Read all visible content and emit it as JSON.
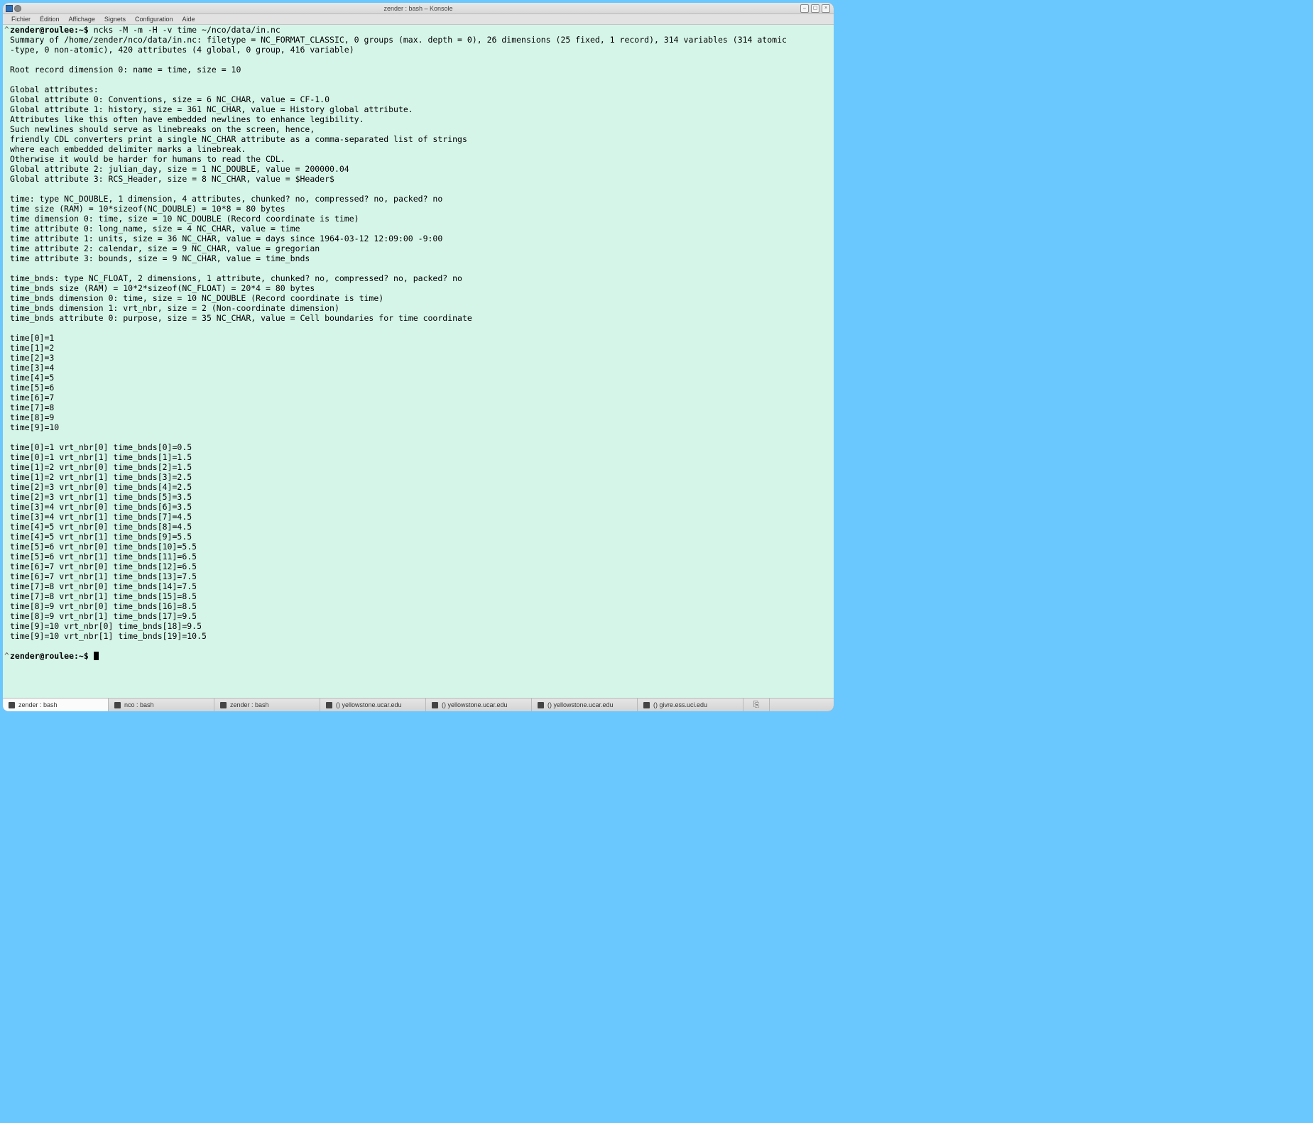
{
  "window": {
    "title": "zender : bash – Konsole"
  },
  "menu": {
    "items": [
      "Fichier",
      "Édition",
      "Affichage",
      "Signets",
      "Configuration",
      "Aide"
    ]
  },
  "prompt": "zender@roulee:~$ ",
  "command": "ncks -M -m -H -v time ~/nco/data/in.nc",
  "output_lines": [
    "Summary of /home/zender/nco/data/in.nc: filetype = NC_FORMAT_CLASSIC, 0 groups (max. depth = 0), 26 dimensions (25 fixed, 1 record), 314 variables (314 atomic",
    "-type, 0 non-atomic), 420 attributes (4 global, 0 group, 416 variable)",
    "",
    "Root record dimension 0: name = time, size = 10",
    "",
    "Global attributes:",
    "Global attribute 0: Conventions, size = 6 NC_CHAR, value = CF-1.0",
    "Global attribute 1: history, size = 361 NC_CHAR, value = History global attribute.",
    "Attributes like this often have embedded newlines to enhance legibility.",
    "Such newlines should serve as linebreaks on the screen, hence,",
    "friendly CDL converters print a single NC_CHAR attribute as a comma-separated list of strings",
    "where each embedded delimiter marks a linebreak.",
    "Otherwise it would be harder for humans to read the CDL.",
    "Global attribute 2: julian_day, size = 1 NC_DOUBLE, value = 200000.04",
    "Global attribute 3: RCS_Header, size = 8 NC_CHAR, value = $Header$",
    "",
    "time: type NC_DOUBLE, 1 dimension, 4 attributes, chunked? no, compressed? no, packed? no",
    "time size (RAM) = 10*sizeof(NC_DOUBLE) = 10*8 = 80 bytes",
    "time dimension 0: time, size = 10 NC_DOUBLE (Record coordinate is time)",
    "time attribute 0: long_name, size = 4 NC_CHAR, value = time",
    "time attribute 1: units, size = 36 NC_CHAR, value = days since 1964-03-12 12:09:00 -9:00",
    "time attribute 2: calendar, size = 9 NC_CHAR, value = gregorian",
    "time attribute 3: bounds, size = 9 NC_CHAR, value = time_bnds",
    "",
    "time_bnds: type NC_FLOAT, 2 dimensions, 1 attribute, chunked? no, compressed? no, packed? no",
    "time_bnds size (RAM) = 10*2*sizeof(NC_FLOAT) = 20*4 = 80 bytes",
    "time_bnds dimension 0: time, size = 10 NC_DOUBLE (Record coordinate is time)",
    "time_bnds dimension 1: vrt_nbr, size = 2 (Non-coordinate dimension)",
    "time_bnds attribute 0: purpose, size = 35 NC_CHAR, value = Cell boundaries for time coordinate",
    "",
    "time[0]=1",
    "time[1]=2",
    "time[2]=3",
    "time[3]=4",
    "time[4]=5",
    "time[5]=6",
    "time[6]=7",
    "time[7]=8",
    "time[8]=9",
    "time[9]=10",
    "",
    "time[0]=1 vrt_nbr[0] time_bnds[0]=0.5",
    "time[0]=1 vrt_nbr[1] time_bnds[1]=1.5",
    "time[1]=2 vrt_nbr[0] time_bnds[2]=1.5",
    "time[1]=2 vrt_nbr[1] time_bnds[3]=2.5",
    "time[2]=3 vrt_nbr[0] time_bnds[4]=2.5",
    "time[2]=3 vrt_nbr[1] time_bnds[5]=3.5",
    "time[3]=4 vrt_nbr[0] time_bnds[6]=3.5",
    "time[3]=4 vrt_nbr[1] time_bnds[7]=4.5",
    "time[4]=5 vrt_nbr[0] time_bnds[8]=4.5",
    "time[4]=5 vrt_nbr[1] time_bnds[9]=5.5",
    "time[5]=6 vrt_nbr[0] time_bnds[10]=5.5",
    "time[5]=6 vrt_nbr[1] time_bnds[11]=6.5",
    "time[6]=7 vrt_nbr[0] time_bnds[12]=6.5",
    "time[6]=7 vrt_nbr[1] time_bnds[13]=7.5",
    "time[7]=8 vrt_nbr[0] time_bnds[14]=7.5",
    "time[7]=8 vrt_nbr[1] time_bnds[15]=8.5",
    "time[8]=9 vrt_nbr[0] time_bnds[16]=8.5",
    "time[8]=9 vrt_nbr[1] time_bnds[17]=9.5",
    "time[9]=10 vrt_nbr[0] time_bnds[18]=9.5",
    "time[9]=10 vrt_nbr[1] time_bnds[19]=10.5",
    ""
  ],
  "tabs": {
    "items": [
      "zender : bash",
      "nco : bash",
      "zender : bash",
      "() yellowstone.ucar.edu",
      "() yellowstone.ucar.edu",
      "() yellowstone.ucar.edu",
      "() givre.ess.uci.edu"
    ],
    "active_index": 0
  }
}
